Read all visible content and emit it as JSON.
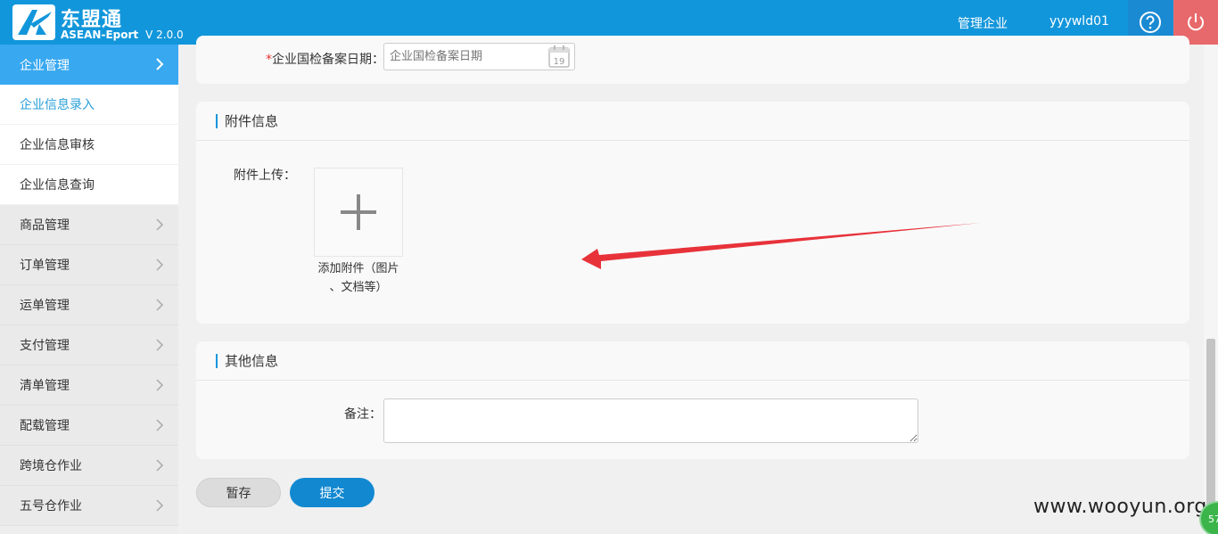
{
  "header": {
    "brand": "东盟通",
    "brand_sub": "ASEAN-Eport",
    "version": "V 2.0.0",
    "company_link": "管理企业",
    "username": "yyywld01",
    "help_icon": "question-circle-icon",
    "power_icon": "power-icon"
  },
  "sidebar": {
    "group": "企业管理",
    "sub_items": [
      "企业信息录入",
      "企业信息审核",
      "企业信息查询"
    ],
    "items": [
      "商品管理",
      "订单管理",
      "运单管理",
      "支付管理",
      "清单管理",
      "配载管理",
      "跨境仓作业",
      "五号仓作业"
    ]
  },
  "form": {
    "date_label": "企业国检备案日期：",
    "date_required_mark": "*",
    "date_placeholder": "企业国检备案日期",
    "calendar_day": "19",
    "attach_section": "附件信息",
    "upload_label": "附件上传：",
    "upload_caption_1": "添加附件（图片",
    "upload_caption_2": "、文档等）",
    "other_section": "其他信息",
    "remark_label": "备注："
  },
  "actions": {
    "draft": "暂存",
    "submit": "提交"
  },
  "overlay": {
    "watermark": "www.wooyun.org",
    "badge": "57"
  },
  "colors": {
    "primary": "#1296db",
    "sidebar_active": "#38a8f0",
    "danger": "#e8696b",
    "annotation_arrow": "#e8323a"
  }
}
